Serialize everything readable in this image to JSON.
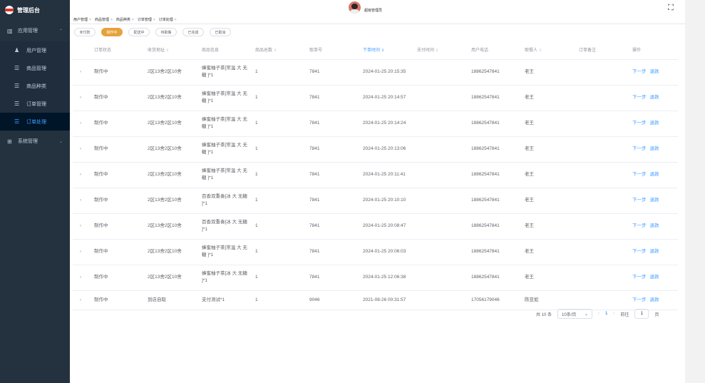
{
  "sidebar": {
    "brand": "管理后台",
    "group1": "应用管理",
    "items": [
      "用户管理",
      "商品管理",
      "商品种类",
      "订单管理",
      "订单处理"
    ],
    "group2": "系统管理"
  },
  "header": {
    "username": "超级管理员"
  },
  "tags": [
    "用户管理",
    "商品管理",
    "商品种类",
    "订单管理",
    "订单处理"
  ],
  "filters": [
    "未付款",
    "制作中",
    "配送中",
    "待取餐",
    "已完成",
    "已取消"
  ],
  "table": {
    "headers": [
      "订单状态",
      "收货地址",
      "商品信息",
      "商品总数",
      "取单号",
      "下单时间",
      "支付时间",
      "用户电话",
      "取餐人",
      "订单备注",
      "操作"
    ],
    "rows": [
      [
        "制作中",
        "2区13舍2区10舍",
        "蜂蜜柚子茶[常温 大 无糖 ]*1",
        "1",
        "7841",
        "2024-01-25 20:15:35",
        "",
        "18862547841",
        "老王",
        "",
        "下一步",
        "退款"
      ],
      [
        "制作中",
        "2区13舍2区10舍",
        "蜂蜜柚子茶[常温 大 无糖 ]*1",
        "1",
        "7841",
        "2024-01-25 20:14:57",
        "",
        "18862547841",
        "老王",
        "",
        "下一步",
        "退款"
      ],
      [
        "制作中",
        "2区13舍2区10舍",
        "蜂蜜柚子茶[常温 大 无糖 ]*1",
        "1",
        "7841",
        "2024-01-25 20:14:24",
        "",
        "18862547841",
        "老王",
        "",
        "下一步",
        "退款"
      ],
      [
        "制作中",
        "2区13舍2区10舍",
        "蜂蜜柚子茶[常温 大 无糖 ]*1",
        "1",
        "7841",
        "2024-01-25 20:13:06",
        "",
        "18862547841",
        "老王",
        "",
        "下一步",
        "退款"
      ],
      [
        "制作中",
        "2区13舍2区10舍",
        "蜂蜜柚子茶[常温 大 无糖 ]*1",
        "1",
        "7841",
        "2024-01-25 20:11:41",
        "",
        "18862547841",
        "老王",
        "",
        "下一步",
        "退款"
      ],
      [
        "制作中",
        "2区13舍2区10舍",
        "百香双重奏[冰 大 无糖 ]*1",
        "1",
        "7841",
        "2024-01-25 20:10:10",
        "",
        "18862547841",
        "老王",
        "",
        "下一步",
        "退款"
      ],
      [
        "制作中",
        "2区13舍2区10舍",
        "百香双重奏[冰 大 无糖 ]*1",
        "1",
        "7841",
        "2024-01-25 20:08:47",
        "",
        "18862547841",
        "老王",
        "",
        "下一步",
        "退款"
      ],
      [
        "制作中",
        "2区13舍2区10舍",
        "蜂蜜柚子茶[常温 大 无糖 ]*1",
        "1",
        "7841",
        "2024-01-25 20:06:03",
        "",
        "18862547841",
        "老王",
        "",
        "下一步",
        "退款"
      ],
      [
        "制作中",
        "2区13舍2区10舍",
        "蜂蜜柚子茶[冰 大 无糖 ]*1",
        "1",
        "7841",
        "2024-01-25 12:06:38",
        "",
        "18862547841",
        "老王",
        "",
        "下一步",
        "退款"
      ],
      [
        "制作中",
        "到店自取",
        "支付测试*1",
        "1",
        "9046",
        "2021-08-26 00:31:57",
        "",
        "17056179046",
        "陈亚如",
        "",
        "下一步",
        "退款"
      ]
    ]
  },
  "pagination": {
    "total": "共 10 条",
    "page_size": "10条/页",
    "current": "1",
    "goto": "前往",
    "page": "1",
    "unit": "页"
  }
}
